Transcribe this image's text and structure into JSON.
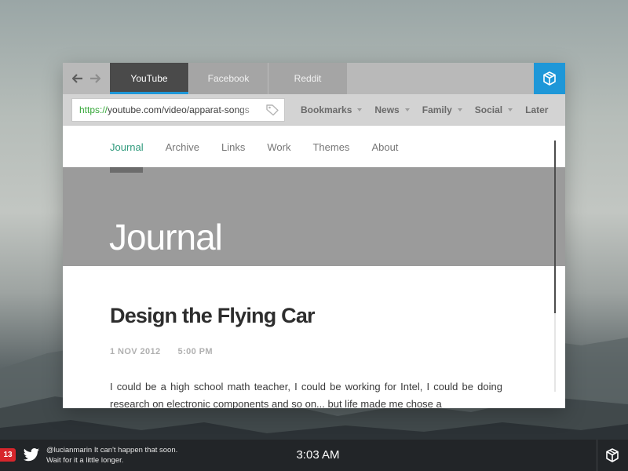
{
  "browser": {
    "tabs": [
      {
        "label": "YouTube",
        "active": true
      },
      {
        "label": "Facebook",
        "active": false
      },
      {
        "label": "Reddit",
        "active": false
      }
    ],
    "url": {
      "scheme": "https://",
      "rest": "youtube.com/video/apparat-songs"
    },
    "bookmarks": [
      "Bookmarks",
      "News",
      "Family",
      "Social",
      "Later"
    ],
    "accent_color": "#1e97d8"
  },
  "site": {
    "nav": [
      "Journal",
      "Archive",
      "Links",
      "Work",
      "Themes",
      "About"
    ],
    "active_nav": "Journal",
    "hero_title": "Journal",
    "post": {
      "title": "Design the Flying Car",
      "date": "1 NOV 2012",
      "time": "5:00 PM",
      "body": "I could be a high school math teacher, I could be working for Intel, I could be doing research on electronic components and so on... but life made me chose a"
    }
  },
  "taskbar": {
    "badge_count": "13",
    "tweet_line1": "@lucianmarin It can't happen that soon.",
    "tweet_line2": "Wait for it a little longer.",
    "clock": "3:03 AM"
  },
  "icons": {
    "back": "arrow-left-icon",
    "forward": "arrow-right-icon",
    "extension": "cube-icon",
    "tag": "tag-icon",
    "twitter": "twitter-bird-icon",
    "tray": "cube-icon"
  }
}
